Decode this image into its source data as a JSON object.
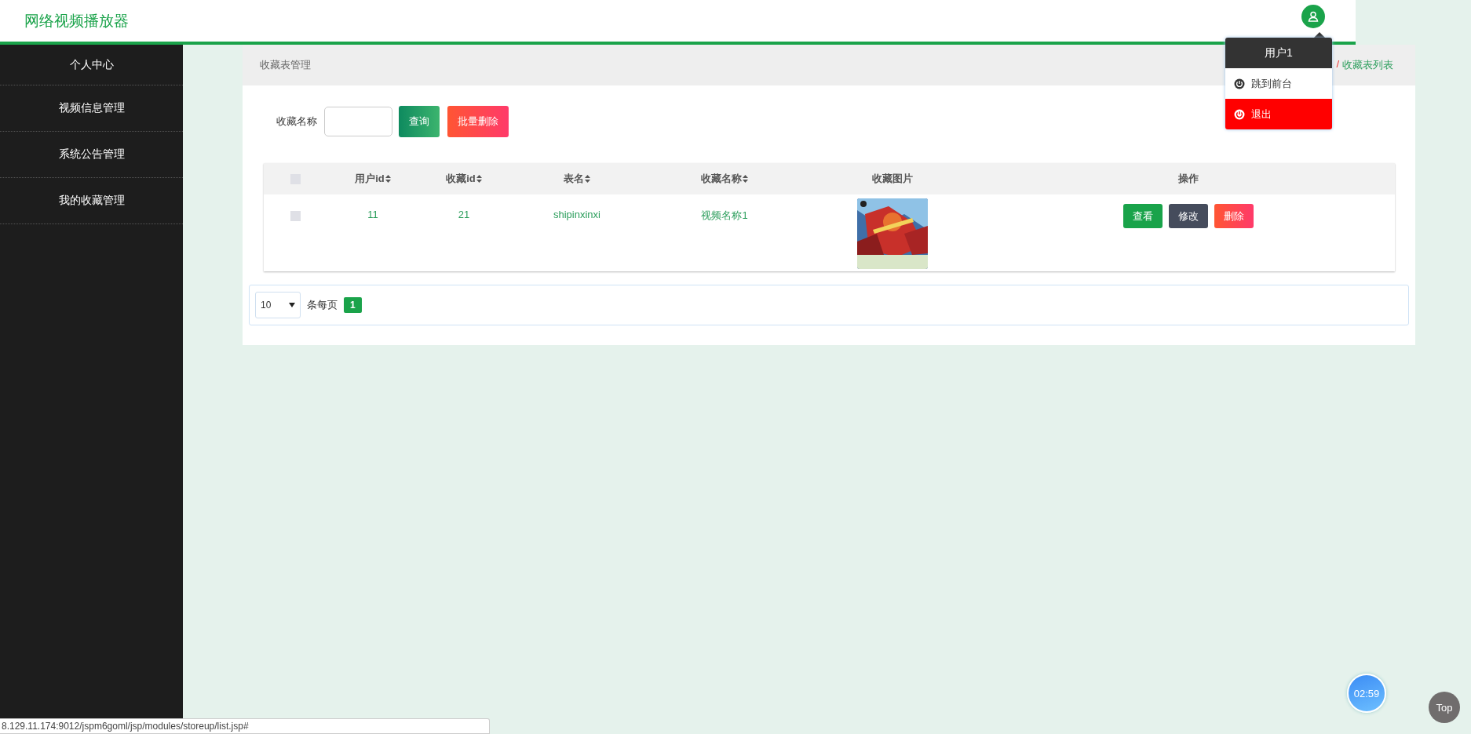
{
  "header": {
    "title": "网络视频播放器"
  },
  "sidebar": {
    "items": [
      {
        "label": "个人中心"
      },
      {
        "label": "视频信息管理"
      },
      {
        "label": "系统公告管理"
      },
      {
        "label": "我的收藏管理"
      }
    ]
  },
  "breadcrumb": {
    "title": "收藏表管理",
    "separator": "/",
    "current": "收藏表列表"
  },
  "search": {
    "label": "收藏名称",
    "buttons": [
      {
        "label": "查询",
        "kind": "search"
      },
      {
        "label": "批量删除",
        "kind": "danger"
      }
    ]
  },
  "table": {
    "select_all": {
      "checked": false
    },
    "columns": [
      {
        "label": "用户id",
        "sortable": true
      },
      {
        "label": "收藏id",
        "sortable": true
      },
      {
        "label": "表名",
        "sortable": true
      },
      {
        "label": "收藏名称",
        "sortable": true
      },
      {
        "label": "收藏图片",
        "sortable": false
      },
      {
        "label": "操作",
        "sortable": false
      }
    ],
    "rows": [
      {
        "checked": false,
        "cells": [
          "11",
          "21",
          "shipinxinxi",
          "视频名称1"
        ],
        "image": {
          "kind": "picture"
        },
        "actions": [
          {
            "label": "查看",
            "kind": "view"
          },
          {
            "label": "修改",
            "kind": "edit"
          },
          {
            "label": "删除",
            "kind": "delete"
          }
        ]
      }
    ]
  },
  "pagination": {
    "page_size": "10",
    "per_page_label": "条每页",
    "pages": [
      {
        "label": "1",
        "selected": true
      }
    ]
  },
  "user_menu": {
    "name": "用户1",
    "items": [
      {
        "label": "跳到前台",
        "selected": false
      },
      {
        "label": "退出",
        "selected": true
      }
    ]
  },
  "timer": "02:59",
  "top_button": "Top",
  "status_bar": "8.129.11.174:9012/jspm6goml/jsp/modules/storeup/list.jsp#"
}
